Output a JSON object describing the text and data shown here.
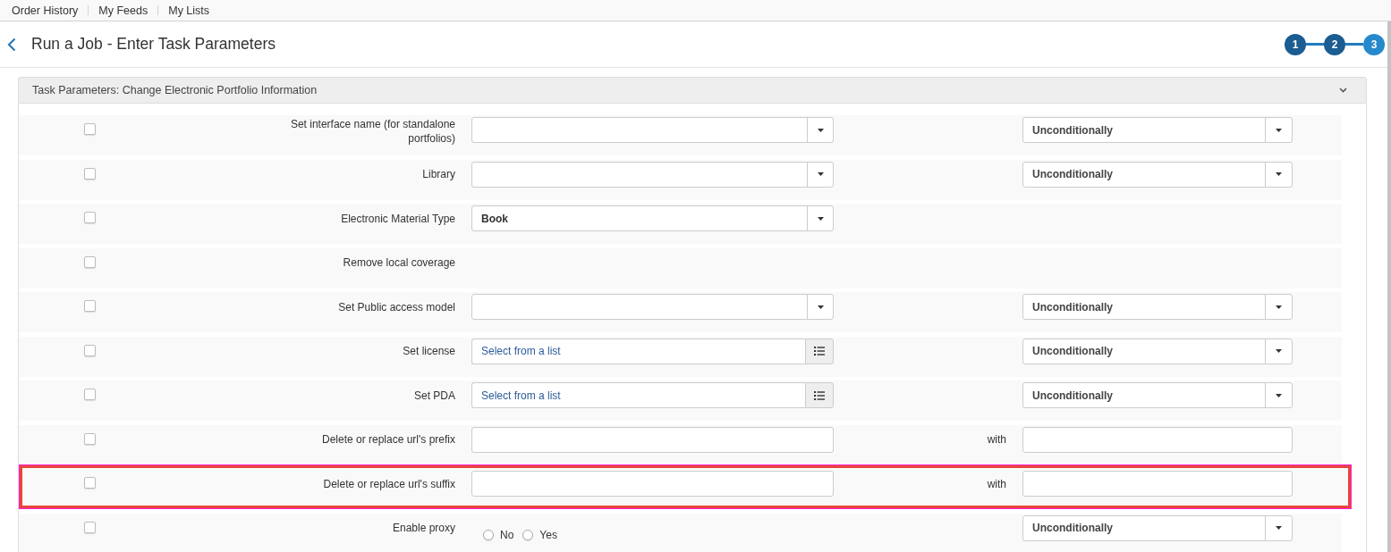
{
  "top_nav": {
    "links": [
      "Order History",
      "My Feeds",
      "My Lists"
    ]
  },
  "header": {
    "title": "Run a Job - Enter Task Parameters",
    "steps": [
      {
        "label": "1",
        "current": false
      },
      {
        "label": "2",
        "current": false
      },
      {
        "label": "3",
        "current": true
      }
    ]
  },
  "panel": {
    "title": "Task Parameters: Change Electronic Portfolio Information",
    "expanded": true,
    "rows": [
      {
        "label": "Set interface name (for standalone portfolios)",
        "checked": false,
        "highlighted": false,
        "field": {
          "kind": "dropdown"
        },
        "condition": {
          "kind": "dropdown",
          "value": "Unconditionally"
        }
      },
      {
        "label": "Library",
        "checked": false,
        "highlighted": false,
        "field": {
          "kind": "dropdown"
        },
        "condition": {
          "kind": "dropdown",
          "value": "Unconditionally"
        }
      },
      {
        "label": "Electronic Material Type",
        "checked": false,
        "highlighted": false,
        "field": {
          "kind": "dropdown",
          "value": "Book"
        }
      },
      {
        "label": "Remove local coverage",
        "checked": false,
        "highlighted": false
      },
      {
        "label": "Set Public access model",
        "checked": false,
        "highlighted": false,
        "field": {
          "kind": "dropdown"
        },
        "condition": {
          "kind": "dropdown",
          "value": "Unconditionally"
        }
      },
      {
        "label": "Set license",
        "checked": false,
        "highlighted": false,
        "field": {
          "kind": "picker",
          "placeholder": "Select from a list"
        },
        "condition": {
          "kind": "dropdown",
          "value": "Unconditionally"
        }
      },
      {
        "label": "Set PDA",
        "checked": false,
        "highlighted": false,
        "field": {
          "kind": "picker",
          "placeholder": "Select from a list"
        },
        "condition": {
          "kind": "dropdown",
          "value": "Unconditionally"
        }
      },
      {
        "label": "Delete or replace url's prefix",
        "checked": false,
        "highlighted": false,
        "field": {
          "kind": "text"
        },
        "condition": {
          "kind": "replace",
          "label": "with"
        }
      },
      {
        "label": "Delete or replace url's suffix",
        "checked": false,
        "highlighted": true,
        "field": {
          "kind": "text"
        },
        "condition": {
          "kind": "replace",
          "label": "with"
        }
      },
      {
        "label": "Enable proxy",
        "checked": false,
        "highlighted": false,
        "field": {
          "kind": "radios",
          "options": [
            {
              "label": "No",
              "selected": false
            },
            {
              "label": "Yes",
              "selected": false
            }
          ]
        },
        "condition": {
          "kind": "dropdown",
          "value": "Unconditionally"
        }
      }
    ]
  }
}
